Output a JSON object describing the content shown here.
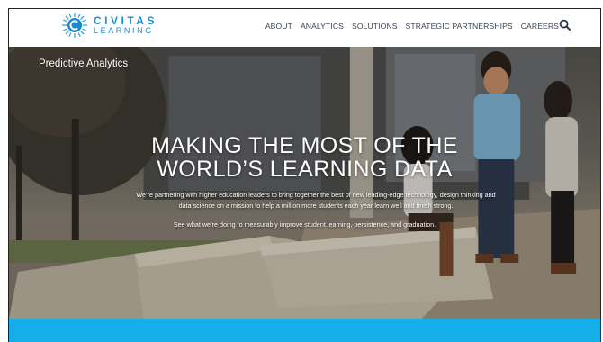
{
  "header": {
    "logo": {
      "line1": "CIVITAS",
      "line2": "LEARNING"
    },
    "nav": [
      {
        "label": "ABOUT"
      },
      {
        "label": "ANALYTICS"
      },
      {
        "label": "SOLUTIONS"
      },
      {
        "label": "STRATEGIC PARTNERSHIPS"
      },
      {
        "label": "CAREERS"
      }
    ],
    "search_icon": "search-icon"
  },
  "hero": {
    "tag": "Predictive Analytics",
    "headline_line1": "MAKING THE MOST OF THE",
    "headline_line2": "WORLD’S LEARNING DATA",
    "description_line1": "We’re partnering with higher education leaders to bring together the best of new leading-edge technology, design thinking and",
    "description_line2": "data science on a mission to help a million more students each year learn well and finish strong.",
    "cta_text": "See what we’re doing to measurably improve student learning, persistence, and graduation."
  },
  "colors": {
    "brand_blue": "#1d8fd1",
    "band_blue": "#14aee8",
    "nav_text": "#3a4450"
  }
}
